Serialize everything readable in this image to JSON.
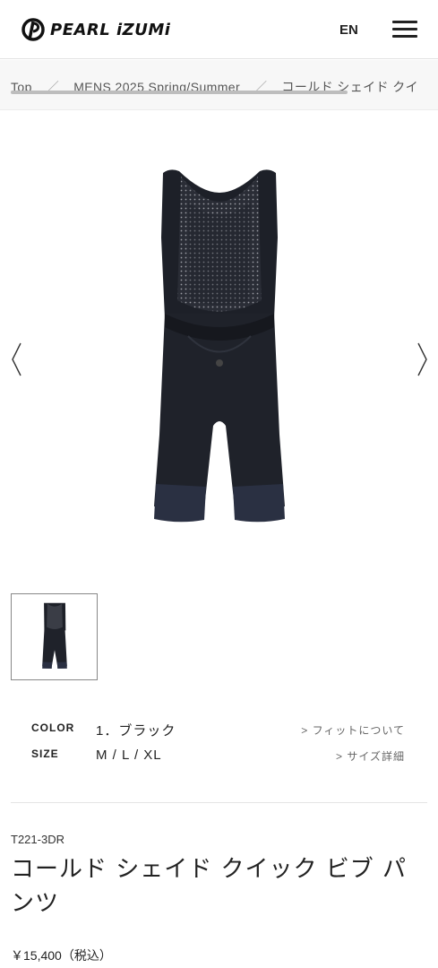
{
  "header": {
    "brand": "PEARL iZUMi",
    "lang_label": "EN"
  },
  "breadcrumb": {
    "items": [
      "Top",
      "MENS 2025 Spring/Summer",
      "コールド シェイド クイ"
    ],
    "separator": "／"
  },
  "gallery": {
    "image_alt": "bib pants, black"
  },
  "specs": {
    "color_label": "COLOR",
    "color_value": "1．ブラック",
    "size_label": "SIZE",
    "size_value": "M / L / XL",
    "fit_link": "> フィットについて",
    "size_link": "> サイズ詳細"
  },
  "product": {
    "sku": "T221-3DR",
    "title": "コールド シェイド クイック ビブ パンツ",
    "price": "￥15,400（税込）"
  },
  "colors": {
    "garment": "#1d2028",
    "mesh": "#2a2d36",
    "accent": "#222222"
  }
}
